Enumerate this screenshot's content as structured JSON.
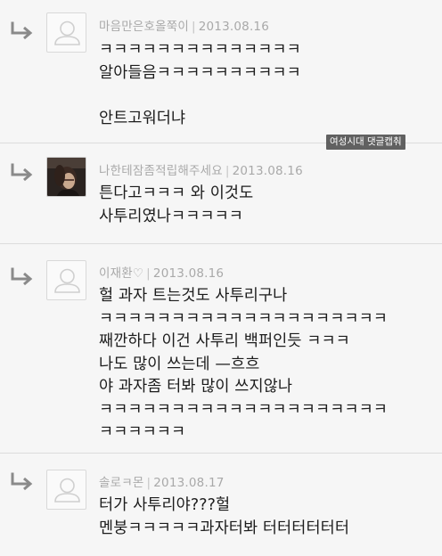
{
  "comments": [
    {
      "author": "마음만은호올쭉이",
      "date": "2013.08.16",
      "lines": [
        "ㅋㅋㅋㅋㅋㅋㅋㅋㅋㅋㅋㅋㅋㅋ",
        "알아들음ㅋㅋㅋㅋㅋㅋㅋㅋㅋㅋ",
        "",
        "안트고워더냐"
      ],
      "avatar": "default-avatar-icon"
    },
    {
      "author": "나한테잠좀적립해주세요",
      "date": "2013.08.16",
      "lines": [
        "튼다고ㅋㅋㅋ 와 이것도",
        "사투리였나ㅋㅋㅋㅋㅋ"
      ],
      "avatar": "photo-avatar"
    },
    {
      "author": "이재환♡",
      "date": "2013.08.16",
      "lines": [
        "헐 과자 트는것도 사투리구나",
        "ㅋㅋㅋㅋㅋㅋㅋㅋㅋㅋㅋㅋㅋㅋㅋㅋㅋㅋㅋㅋ",
        "째깐하다 이건 사투리 백퍼인듯 ㅋㅋㅋ",
        "나도 많이 쓰는데 —흐흐",
        "야 과자좀 터봐 많이 쓰지않나",
        "ㅋㅋㅋㅋㅋㅋㅋㅋㅋㅋㅋㅋㅋㅋㅋㅋㅋㅋㅋㅋ",
        "ㅋㅋㅋㅋㅋㅋ"
      ],
      "avatar": "default-avatar-icon"
    },
    {
      "author": "솔로ㅋ몬",
      "date": "2013.08.17",
      "lines": [
        "터가 사투리야???헐",
        "멘붕ㅋㅋㅋㅋㅋ과자터봐 터터터터터터"
      ],
      "avatar": "default-avatar-icon"
    }
  ],
  "watermark": "여성시대 댓글캡춰",
  "colors": {
    "background": "#f6f6f6",
    "meta_text": "#a9a9a9",
    "body_text": "#1c1c1c",
    "separator": "#dcdcdc"
  }
}
